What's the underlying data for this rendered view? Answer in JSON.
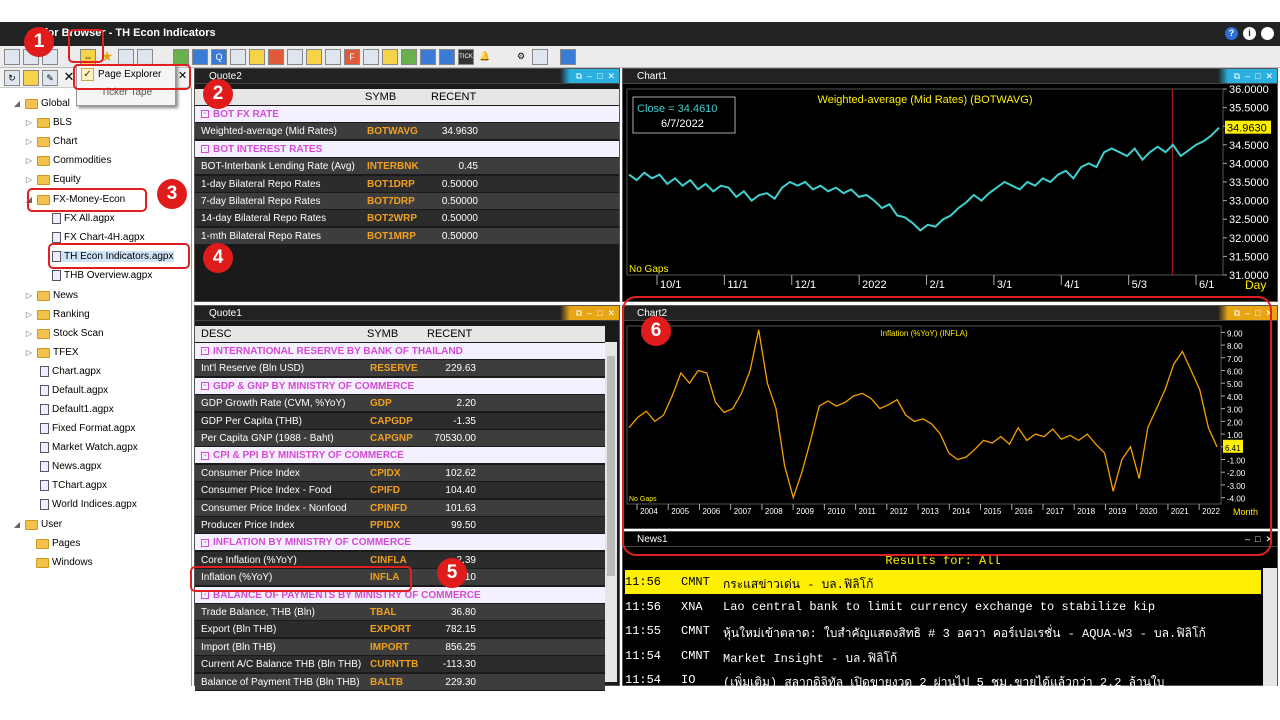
{
  "window": {
    "title": "Aspen for Browser - TH Econ Indicators",
    "title_visible": "en for Browser  - TH Econ Indicators"
  },
  "menu": {
    "items": [
      "Page Explorer",
      "Ticker Tape"
    ]
  },
  "tree": {
    "global": "Global",
    "global_children": [
      "BLS",
      "Chart",
      "Commodities",
      "Equity"
    ],
    "fx_folder": "FX-Money-Econ",
    "fx_files": [
      "FX All.agpx",
      "FX Chart-4H.agpx",
      "TH Econ Indicators.agpx",
      "THB Overview.agpx"
    ],
    "more_folders": [
      "News",
      "Ranking",
      "Stock Scan",
      "TFEX"
    ],
    "files": [
      "Chart.agpx",
      "Default.agpx",
      "Default1.agpx",
      "Fixed Format.agpx",
      "Market Watch.agpx",
      "News.agpx",
      "TChart.agpx",
      "World Indices.agpx"
    ],
    "user": "User",
    "user_children": [
      "Pages",
      "Windows"
    ]
  },
  "quote2": {
    "title": "Quote2",
    "cols": [
      "SYMB",
      "RECENT"
    ],
    "rows": [
      {
        "type": "sec",
        "desc": "BOT FX RATE"
      },
      {
        "desc": "Weighted-average (Mid Rates)",
        "symb": "BOTWAVG",
        "val": "34.9630"
      },
      {
        "type": "sec",
        "desc": "BOT INTEREST RATES"
      },
      {
        "desc": "BOT-Interbank Lending Rate (Avg)",
        "symb": "INTERBNK",
        "val": "0.45"
      },
      {
        "desc": "1-day Bilateral Repo Rates",
        "symb": "BOT1DRP",
        "val": "0.50000"
      },
      {
        "desc": "7-day Bilateral Repo Rates",
        "symb": "BOT7DRP",
        "val": "0.50000"
      },
      {
        "desc": "14-day Bilateral Repo Rates",
        "symb": "BOT2WRP",
        "val": "0.50000"
      },
      {
        "desc": "1-mth Bilateral Repo Rates",
        "symb": "BOT1MRP",
        "val": "0.50000"
      }
    ]
  },
  "quote1": {
    "title": "Quote1",
    "cols": [
      "DESC",
      "SYMB",
      "RECENT"
    ],
    "rows": [
      {
        "type": "sec",
        "desc": "INTERNATIONAL RESERVE BY BANK OF THAILAND"
      },
      {
        "desc": "Int'l Reserve (Bln USD)",
        "symb": "RESERVE",
        "val": "229.63"
      },
      {
        "type": "sec",
        "desc": "GDP & GNP BY MINISTRY OF COMMERCE"
      },
      {
        "desc": "GDP Growth Rate (CVM, %YoY)",
        "symb": "GDP",
        "val": "2.20"
      },
      {
        "desc": "GDP Per Capita (THB)",
        "symb": "CAPGDP",
        "val": "-1.35"
      },
      {
        "desc": "Per Capita GNP (1988 - Baht)",
        "symb": "CAPGNP",
        "val": "70530.00"
      },
      {
        "type": "sec",
        "desc": "CPI & PPI BY MINISTRY OF COMMERCE"
      },
      {
        "desc": "Consumer Price Index",
        "symb": "CPIDX",
        "val": "102.62"
      },
      {
        "desc": "Consumer Price Index - Food",
        "symb": "CPIFD",
        "val": "104.40"
      },
      {
        "desc": "Consumer Price Index - Nonfood",
        "symb": "CPINFD",
        "val": "101.63"
      },
      {
        "desc": "Producer Price Index",
        "symb": "PPIDX",
        "val": "99.50"
      },
      {
        "type": "sec",
        "desc": "INFLATION BY MINISTRY OF COMMERCE"
      },
      {
        "desc": "Core Inflation (%YoY)",
        "symb": "CINFLA",
        "val": "2.39"
      },
      {
        "desc": "Inflation (%YoY)",
        "symb": "INFLA",
        "val": "7.10"
      },
      {
        "type": "sec",
        "desc": "BALANCE OF PAYMENTS BY MINISTRY OF COMMERCE"
      },
      {
        "desc": "Trade Balance, THB (Bln)",
        "symb": "TBAL",
        "val": "36.80"
      },
      {
        "desc": "Export (Bln THB)",
        "symb": "EXPORT",
        "val": "782.15"
      },
      {
        "desc": "Import (Bln THB)",
        "symb": "IMPORT",
        "val": "856.25"
      },
      {
        "desc": "Current A/C Balance THB (Bln THB)",
        "symb": "CURNTTB",
        "val": "-113.30"
      },
      {
        "desc": "Balance of Payment THB (Bln THB)",
        "symb": "BALTB",
        "val": "229.30"
      }
    ]
  },
  "chart1": {
    "title": "Chart1",
    "close_label": "Close = 34.4610",
    "close_date": "6/7/2022",
    "nogaps": "No Gaps",
    "day": "Day",
    "last": "34.9630"
  },
  "chart2": {
    "title": "Chart2",
    "nogaps": "No Gaps",
    "month": "Month",
    "last": "6.41"
  },
  "chart_data": [
    {
      "type": "line",
      "title": "Weighted-average (Mid Rates) (BOTWAVG)",
      "xlabel": "",
      "ylabel": "",
      "x_ticks": [
        "10/1",
        "11/1",
        "12/1",
        "2022",
        "2/1",
        "3/1",
        "4/1",
        "5/3",
        "6/1"
      ],
      "y_ticks": [
        "36.0000",
        "35.5000",
        "35.0000",
        "34.5000",
        "34.0000",
        "33.5000",
        "33.0000",
        "32.5000",
        "32.0000",
        "31.5000",
        "31.0000"
      ],
      "ylim": [
        31.0,
        36.0
      ],
      "values": [
        33.7,
        33.55,
        33.75,
        33.6,
        33.7,
        33.45,
        33.6,
        33.4,
        33.55,
        33.3,
        33.45,
        33.25,
        33.4,
        33.35,
        33.1,
        33.25,
        33.0,
        33.15,
        33.2,
        33.05,
        33.35,
        33.5,
        33.4,
        33.5,
        33.3,
        33.4,
        33.25,
        33.35,
        33.2,
        33.3,
        33.1,
        33.15,
        33.0,
        32.8,
        32.9,
        32.6,
        32.55,
        32.4,
        32.2,
        32.35,
        32.3,
        32.5,
        32.6,
        32.8,
        32.95,
        33.15,
        33.0,
        33.2,
        33.35,
        33.5,
        33.4,
        33.3,
        33.5,
        33.4,
        33.6,
        33.5,
        33.7,
        33.8,
        33.6,
        33.9,
        34.0,
        33.9,
        34.3,
        34.4,
        34.3,
        34.2,
        34.4,
        34.1,
        34.3,
        34.45,
        34.3,
        34.5,
        34.2,
        34.35,
        34.5,
        34.6,
        34.75,
        34.96
      ]
    },
    {
      "type": "line",
      "title": "Inflation (%YoY) (INFLA)",
      "xlabel": "",
      "ylabel": "",
      "x_ticks": [
        "2004",
        "2005",
        "2006",
        "2007",
        "2008",
        "2009",
        "2010",
        "2011",
        "2012",
        "2013",
        "2014",
        "2015",
        "2016",
        "2017",
        "2018",
        "2019",
        "2020",
        "2021",
        "2022"
      ],
      "y_ticks": [
        "9.00",
        "8.00",
        "7.00",
        "6.00",
        "5.00",
        "4.00",
        "3.00",
        "2.00",
        "1.00",
        "0.00",
        "-1.00",
        "-2.00",
        "-3.00",
        "-4.00"
      ],
      "ylim": [
        -4.5,
        9.5
      ],
      "values": [
        1.5,
        2.3,
        2.8,
        2.0,
        2.5,
        4.0,
        5.8,
        5.0,
        6.0,
        5.8,
        3.5,
        2.7,
        3.0,
        4.2,
        6.0,
        9.2,
        5.0,
        3.0,
        -1.5,
        -4.0,
        -2.0,
        0.5,
        3.2,
        3.6,
        3.2,
        3.5,
        4.0,
        4.2,
        3.8,
        3.0,
        3.3,
        3.7,
        2.5,
        2.0,
        2.2,
        1.8,
        1.0,
        -0.5,
        -1.0,
        -0.8,
        -0.2,
        0.5,
        0.3,
        0.8,
        0.2,
        1.5,
        0.5,
        1.0,
        0.8,
        1.4,
        0.6,
        0.9,
        0.5,
        1.0,
        0.2,
        -0.5,
        -3.5,
        -1.0,
        0.0,
        -2.5,
        1.5,
        3.0,
        4.5,
        6.5,
        7.5,
        6.0,
        4.5,
        1.5,
        0.0
      ]
    }
  ],
  "news": {
    "title": "News1",
    "results": "Results for: All",
    "rows": [
      {
        "time": "11:56",
        "src": "CMNT",
        "text": "กระแสข่าวเด่น - บล.ฟิลิโก้",
        "hl": true
      },
      {
        "time": "11:56",
        "src": "XNA",
        "text": "Lao central bank to limit currency exchange to stabilize kip"
      },
      {
        "time": "11:55",
        "src": "CMNT",
        "text": "หุ้นใหม่เข้าตลาด: ใบสำคัญแสดงสิทธิ # 3 อควา คอร์เปอเรชั่น - AQUA-W3 - บล.ฟิลิโก้"
      },
      {
        "time": "11:54",
        "src": "CMNT",
        "text": "Market Insight - บล.ฟิลิโก้"
      },
      {
        "time": "11:54",
        "src": "IO",
        "text": "(เพิ่มเติม) สลากดิจิทัล เปิดขายงวด 2 ผ่านไป 5 ชม.ขายได้แล้วกว่า 2.2 ล้านใบ"
      }
    ]
  },
  "badges": [
    "1",
    "2",
    "3",
    "4",
    "5",
    "6"
  ],
  "colors": {
    "accent_cyan": "#2bb0e0",
    "accent_orange": "#e8a514",
    "callout": "#e02020",
    "series1": "#40d0d0",
    "series2": "#f5a000",
    "highlight": "#ffef00"
  }
}
